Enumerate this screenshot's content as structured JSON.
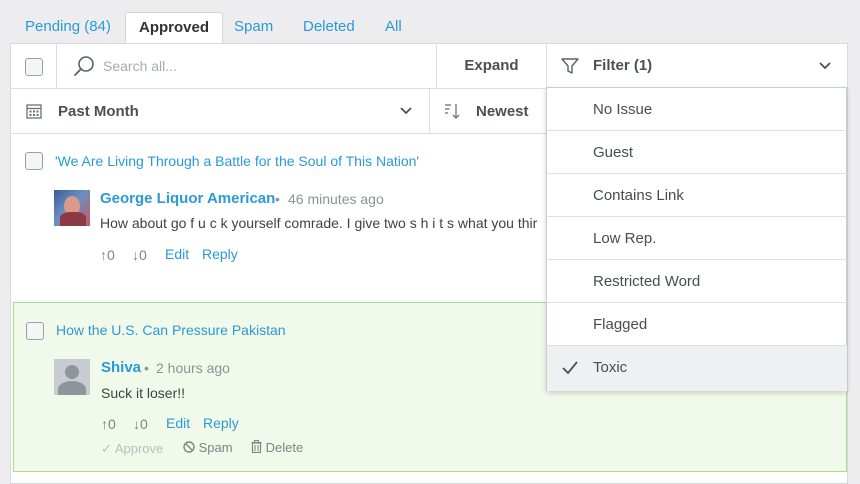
{
  "tabs": [
    {
      "label": "Pending (84)"
    },
    {
      "label": "Approved"
    },
    {
      "label": "Spam"
    },
    {
      "label": "Deleted"
    },
    {
      "label": "All"
    }
  ],
  "toolbar": {
    "search_placeholder": "Search all...",
    "expand_label": "Expand",
    "filter_label": "Filter (1)",
    "date_range": "Past Month",
    "sort": "Newest"
  },
  "filter_options": [
    {
      "label": "No Issue"
    },
    {
      "label": "Guest"
    },
    {
      "label": "Contains Link"
    },
    {
      "label": "Low Rep."
    },
    {
      "label": "Restricted Word"
    },
    {
      "label": "Flagged"
    },
    {
      "label": "Toxic",
      "selected": true
    }
  ],
  "comments": [
    {
      "article": "'We Are Living Through a Battle for the Soul of This Nation'",
      "author": "George Liquor American",
      "time": "46 minutes ago",
      "text": "How about go f u c k yourself comrade. I give two s h i t s what you thir",
      "upvotes": "0",
      "downvotes": "0",
      "edit": "Edit",
      "reply": "Reply"
    },
    {
      "article": "How the U.S. Can Pressure Pakistan",
      "author": "Shiva",
      "time": "2 hours ago",
      "text": "Suck it loser!!",
      "upvotes": "0",
      "downvotes": "0",
      "edit": "Edit",
      "reply": "Reply",
      "approve": "Approve",
      "spam": "Spam",
      "delete": "Delete"
    }
  ],
  "colors": {
    "accent": "#2a9ad6",
    "highlight_bg": "#f1faea",
    "highlight_border": "#a9dc8f"
  }
}
